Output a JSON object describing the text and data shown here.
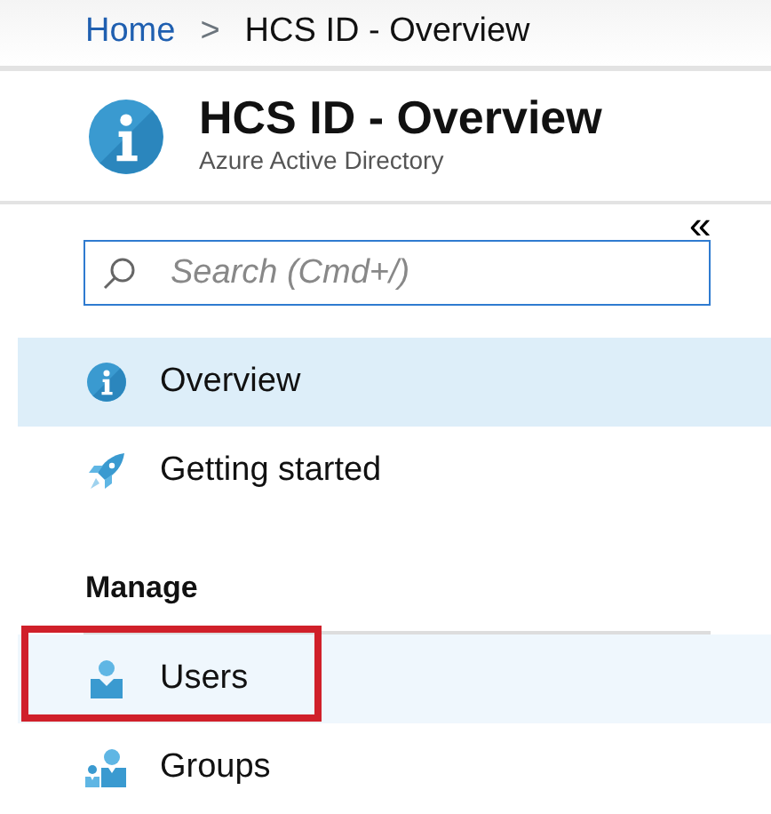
{
  "breadcrumb": [
    {
      "label": "Home",
      "kind": "link"
    },
    {
      "label": "HCS ID - Overview",
      "kind": "current"
    }
  ],
  "breadcrumb_separator": ">",
  "header": {
    "title": "HCS ID - Overview",
    "subtitle": "Azure Active Directory"
  },
  "search": {
    "placeholder": "Search (Cmd+/)"
  },
  "collapse_button": "«",
  "menu": [
    {
      "kind": "item",
      "label": "Overview",
      "selected": true,
      "hovered": false,
      "annotated": false
    },
    {
      "kind": "item",
      "label": "Getting started",
      "selected": false,
      "hovered": false,
      "annotated": false
    },
    {
      "kind": "section",
      "label": "Manage"
    },
    {
      "kind": "item",
      "label": "Users",
      "selected": false,
      "hovered": true,
      "annotated": true
    },
    {
      "kind": "item",
      "label": "Groups",
      "selected": false,
      "hovered": false,
      "annotated": false
    }
  ]
}
